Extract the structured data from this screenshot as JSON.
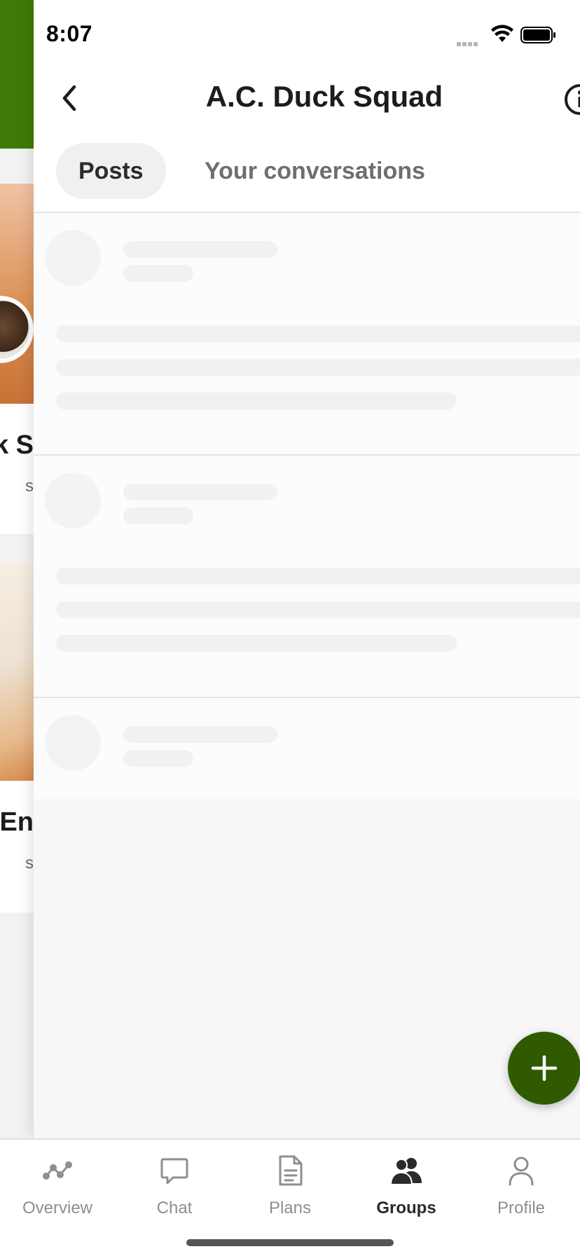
{
  "status_bar": {
    "time": "8:07"
  },
  "background_page": {
    "card_1": {
      "title_fragment": "ck S",
      "subtitle_fragment": "s"
    },
    "card_2": {
      "title_fragment": "k En",
      "subtitle_fragment": "s"
    }
  },
  "header": {
    "title": "A.C. Duck Squad",
    "back_icon": "chevron-left-icon",
    "info_icon": "info-icon"
  },
  "tabs": [
    {
      "label": "Posts",
      "active": true
    },
    {
      "label": "Your conversations",
      "active": false
    }
  ],
  "feed": {
    "state": "loading",
    "skeleton_cards": 3
  },
  "fab": {
    "icon": "plus-icon"
  },
  "tab_bar": {
    "items": [
      {
        "label": "Overview",
        "icon": "activity-icon",
        "active": false
      },
      {
        "label": "Chat",
        "icon": "chat-bubble-icon",
        "active": false
      },
      {
        "label": "Plans",
        "icon": "document-icon",
        "active": false
      },
      {
        "label": "Groups",
        "icon": "people-icon",
        "active": true
      },
      {
        "label": "Profile",
        "icon": "person-icon",
        "active": false
      }
    ]
  },
  "colors": {
    "brand_green": "#2f5a00",
    "header_green": "#3f7a07",
    "active_tab_bg": "#f0f0f0",
    "inactive_text": "#8e8e93"
  }
}
